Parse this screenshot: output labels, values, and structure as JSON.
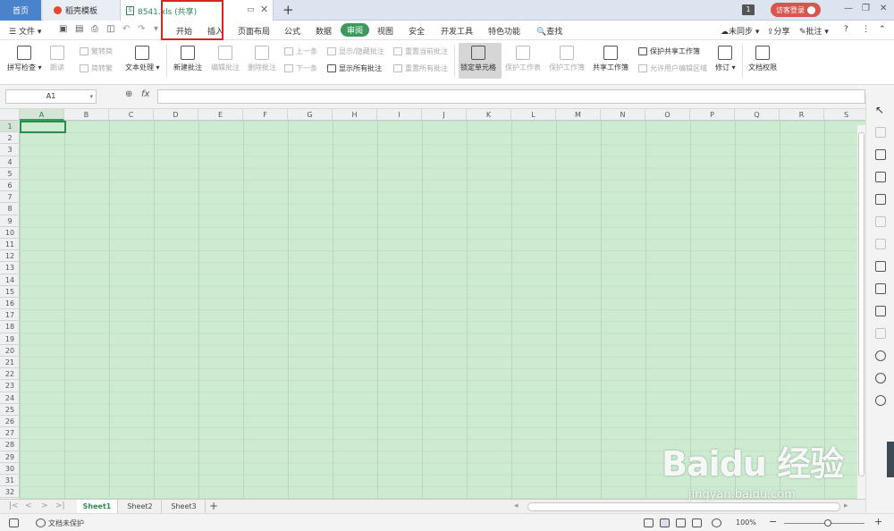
{
  "tabs": {
    "home": "首页",
    "template": "稻壳模板",
    "document": "8541.xls (共享)",
    "window_count": "1",
    "login": "访客登录"
  },
  "menu": {
    "file": "文件",
    "items": [
      "开始",
      "插入",
      "页面布局",
      "公式",
      "数据",
      "审阅",
      "视图",
      "安全",
      "开发工具",
      "特色功能"
    ],
    "active": "审阅",
    "search": "查找",
    "sync": "未同步",
    "share": "分享",
    "comment": "批注"
  },
  "ribbon": {
    "spell_check": "拼写检查",
    "read_aloud": "朗读",
    "trad_to_simp": "繁转简",
    "simp_to_trad": "简转繁",
    "text_process": "文本处理",
    "new_comment": "新建批注",
    "edit_comment": "编辑批注",
    "delete_comment": "删除批注",
    "prev_item": "上一条",
    "next_item": "下一条",
    "show_hide_comment": "显示/隐藏批注",
    "show_all_comments": "显示所有批注",
    "reset_current_comment": "重置当前批注",
    "reset_all_comments": "重置所有批注",
    "lock_cell": "锁定单元格",
    "protect_sheet": "保护工作表",
    "protect_workbook": "保护工作簿",
    "share_workbook": "共享工作簿",
    "protect_shared_workbook": "保护共享工作簿",
    "allow_edit_ranges": "允许用户编辑区域",
    "track_changes": "修订",
    "doc_permission": "文档权限"
  },
  "formula_bar": {
    "name_box": "A1",
    "fx": "fx",
    "value": ""
  },
  "grid": {
    "columns": [
      "A",
      "B",
      "C",
      "D",
      "E",
      "F",
      "G",
      "H",
      "I",
      "J",
      "K",
      "L",
      "M",
      "N",
      "O",
      "P",
      "Q",
      "R",
      "S"
    ],
    "rows": [
      "1",
      "2",
      "3",
      "4",
      "5",
      "6",
      "7",
      "8",
      "9",
      "10",
      "11",
      "12",
      "13",
      "14",
      "15",
      "16",
      "17",
      "18",
      "19",
      "20",
      "21",
      "22",
      "23",
      "24",
      "25",
      "26",
      "27",
      "28",
      "29",
      "30",
      "31",
      "32"
    ],
    "selected_cell": "A1",
    "fill_color": "#ccebd1"
  },
  "sheets": [
    "Sheet1",
    "Sheet2",
    "Sheet3"
  ],
  "active_sheet": "Sheet1",
  "status": {
    "protection": "文档未保护",
    "zoom": "100%"
  },
  "watermark": {
    "main": "Baidu 经验",
    "sub": "jingyan.baidu.com"
  },
  "colors": {
    "accent": "#3c9a5f",
    "highlight_box": "#dd2222",
    "home_tab": "#4a83c9",
    "login": "#d9544f"
  }
}
